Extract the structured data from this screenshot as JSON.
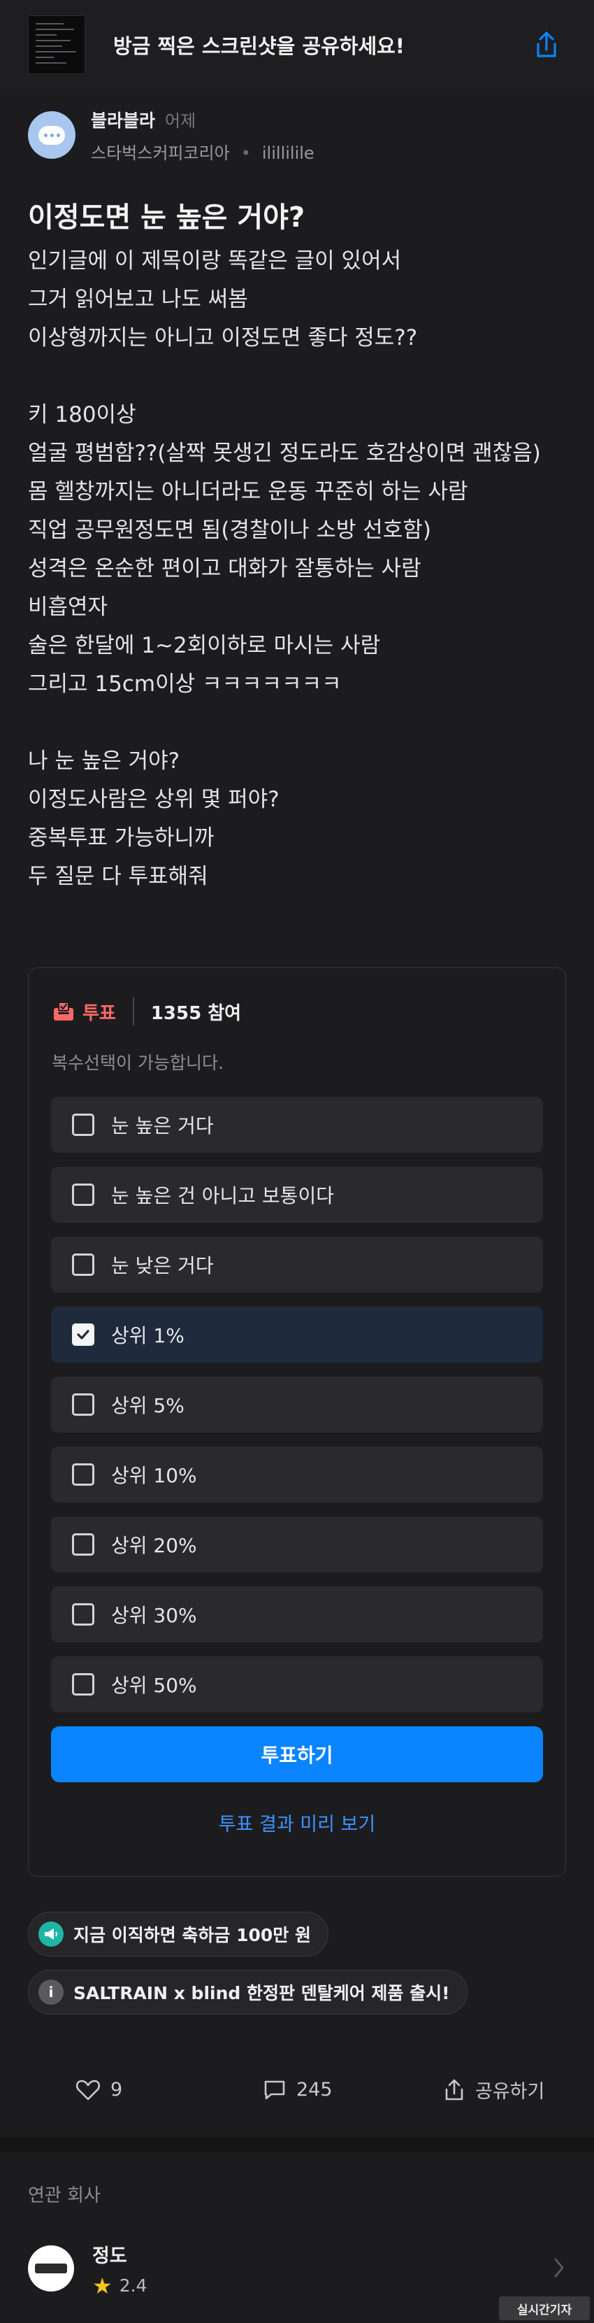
{
  "banner": {
    "text": "방금 찍은 스크린샷을 공유하세요!",
    "share_icon": "share-icon"
  },
  "author": {
    "name": "블라블라",
    "time": "어제",
    "company": "스타벅스커피코리아",
    "handle": "ilillilile"
  },
  "post": {
    "title": "이정도면 눈 높은 거야?",
    "lines": [
      "인기글에 이 제목이랑 똑같은 글이 있어서",
      "그거 읽어보고 나도 써봄",
      "이상형까지는 아니고 이정도면 좋다 정도??",
      "",
      "키 180이상",
      "얼굴 평범함??(살짝 못생긴 정도라도 호감상이면 괜찮음)",
      "몸 헬창까지는 아니더라도 운동 꾸준히 하는 사람",
      "직업 공무원정도면 됨(경찰이나 소방 선호함)",
      "성격은 온순한 편이고 대화가 잘통하는 사람",
      "비흡연자",
      "술은 한달에 1~2회이하로 마시는 사람",
      "그리고 15cm이상 ㅋㅋㅋㅋㅋㅋㅋ",
      "",
      "나 눈 높은 거야?",
      "이정도사람은 상위 몇 퍼야?",
      "중복투표 가능하니까",
      "두 질문 다 투표해줘"
    ]
  },
  "poll": {
    "tag": "투표",
    "count": "1355 참여",
    "hint": "복수선택이 가능합니다.",
    "options": [
      {
        "label": "눈 높은 거다",
        "checked": false
      },
      {
        "label": "눈 높은 건 아니고 보통이다",
        "checked": false
      },
      {
        "label": "눈 낮은 거다",
        "checked": false
      },
      {
        "label": "상위 1%",
        "checked": true
      },
      {
        "label": "상위 5%",
        "checked": false
      },
      {
        "label": "상위 10%",
        "checked": false
      },
      {
        "label": "상위 20%",
        "checked": false
      },
      {
        "label": "상위 30%",
        "checked": false
      },
      {
        "label": "상위 50%",
        "checked": false
      }
    ],
    "vote_button": "투표하기",
    "preview_link": "투표 결과 미리 보기"
  },
  "chips": {
    "promo1": "지금 이직하면 축하금 100만 원",
    "promo2": "SALTRAIN x blind 한정판 덴탈케어 제품 출시!",
    "promo2_icon_text": "i"
  },
  "actions": {
    "likes": "9",
    "comments": "245",
    "share": "공유하기"
  },
  "related": {
    "label": "연관 회사",
    "company_name": "정도",
    "rating": "2.4"
  },
  "watermark": "실시간기자",
  "colors": {
    "accent": "#0a84ff",
    "poll_tag": "#ff6868",
    "star": "#f5c518",
    "background": "#1c1c1e"
  }
}
